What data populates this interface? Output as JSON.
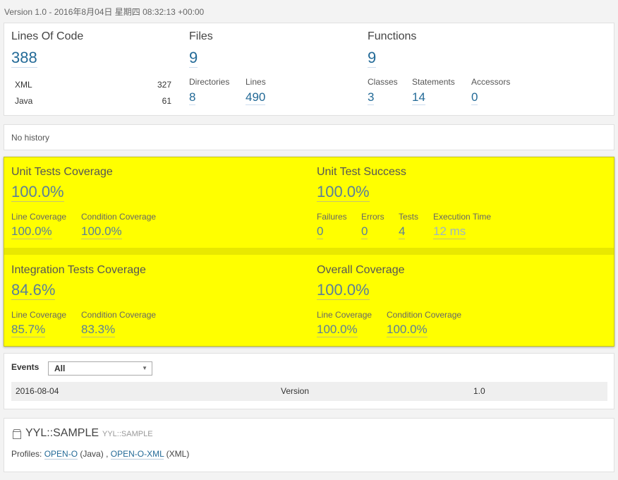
{
  "version_line": "Version 1.0 - 2016年8月04日 星期四 08:32:13 +00:00",
  "size": {
    "loc_label": "Lines Of Code",
    "loc_value": "388",
    "languages": [
      {
        "name": "XML",
        "count": "327"
      },
      {
        "name": "Java",
        "count": "61"
      }
    ],
    "files_label": "Files",
    "files_value": "9",
    "directories_label": "Directories",
    "directories_value": "8",
    "lines_label": "Lines",
    "lines_value": "490",
    "functions_label": "Functions",
    "functions_value": "9",
    "classes_label": "Classes",
    "classes_value": "3",
    "statements_label": "Statements",
    "statements_value": "14",
    "accessors_label": "Accessors",
    "accessors_value": "0"
  },
  "history": {
    "text": "No history"
  },
  "coverage": {
    "unit_label": "Unit Tests Coverage",
    "unit_value": "100.0%",
    "unit_line_label": "Line Coverage",
    "unit_line_value": "100.0%",
    "unit_cond_label": "Condition Coverage",
    "unit_cond_value": "100.0%",
    "success_label": "Unit Test Success",
    "success_value": "100.0%",
    "failures_label": "Failures",
    "failures_value": "0",
    "errors_label": "Errors",
    "errors_value": "0",
    "tests_label": "Tests",
    "tests_value": "4",
    "exec_label": "Execution Time",
    "exec_value": "12 ms",
    "it_label": "Integration Tests Coverage",
    "it_value": "84.6%",
    "it_line_label": "Line Coverage",
    "it_line_value": "85.7%",
    "it_cond_label": "Condition Coverage",
    "it_cond_value": "83.3%",
    "overall_label": "Overall Coverage",
    "overall_value": "100.0%",
    "overall_line_label": "Line Coverage",
    "overall_line_value": "100.0%",
    "overall_cond_label": "Condition Coverage",
    "overall_cond_value": "100.0%",
    "highlight_color": "#ffff00"
  },
  "events": {
    "title": "Events",
    "filter_value": "All",
    "rows": [
      {
        "date": "2016-08-04",
        "type": "Version",
        "name": "1.0"
      }
    ]
  },
  "project": {
    "icon": "project-box-icon",
    "name": "YYL::SAMPLE",
    "key": "YYL::SAMPLE",
    "profiles_label": "Profiles:",
    "profile1_name": "OPEN-O",
    "profile1_lang": "(Java)",
    "separator": ",",
    "profile2_name": "OPEN-O-XML",
    "profile2_lang": "(XML)"
  }
}
